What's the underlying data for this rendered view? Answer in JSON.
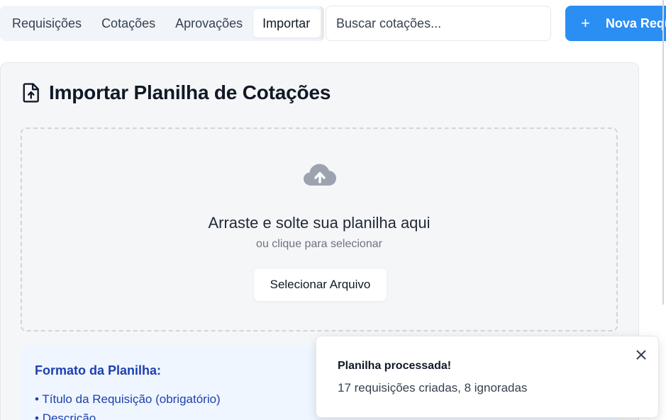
{
  "tabs": [
    {
      "label": "Requisições",
      "active": false
    },
    {
      "label": "Cotações",
      "active": false
    },
    {
      "label": "Aprovações",
      "active": false
    },
    {
      "label": "Importar",
      "active": true
    }
  ],
  "search": {
    "placeholder": "Buscar cotações...",
    "value": ""
  },
  "new_button": {
    "icon": "plus-icon",
    "label": "Nova Requ"
  },
  "colors": {
    "primary": "#2b8ef3",
    "info_text": "#1e40af",
    "info_bg": "#eff6ff"
  },
  "import_card": {
    "icon": "file-upload-icon",
    "title": "Importar Planilha de Cotações",
    "dropzone": {
      "icon": "cloud-upload-icon",
      "title": "Arraste e solte sua planilha aqui",
      "subtitle": "ou clique para selecionar",
      "button_label": "Selecionar Arquivo"
    },
    "format": {
      "title": "Formato da Planilha:",
      "items": [
        "Título da Requisição (obrigatório)",
        "Descrição"
      ]
    }
  },
  "toast": {
    "title": "Planilha processada!",
    "description": "17 requisições criadas, 8 ignoradas",
    "close_icon": "close-icon"
  }
}
